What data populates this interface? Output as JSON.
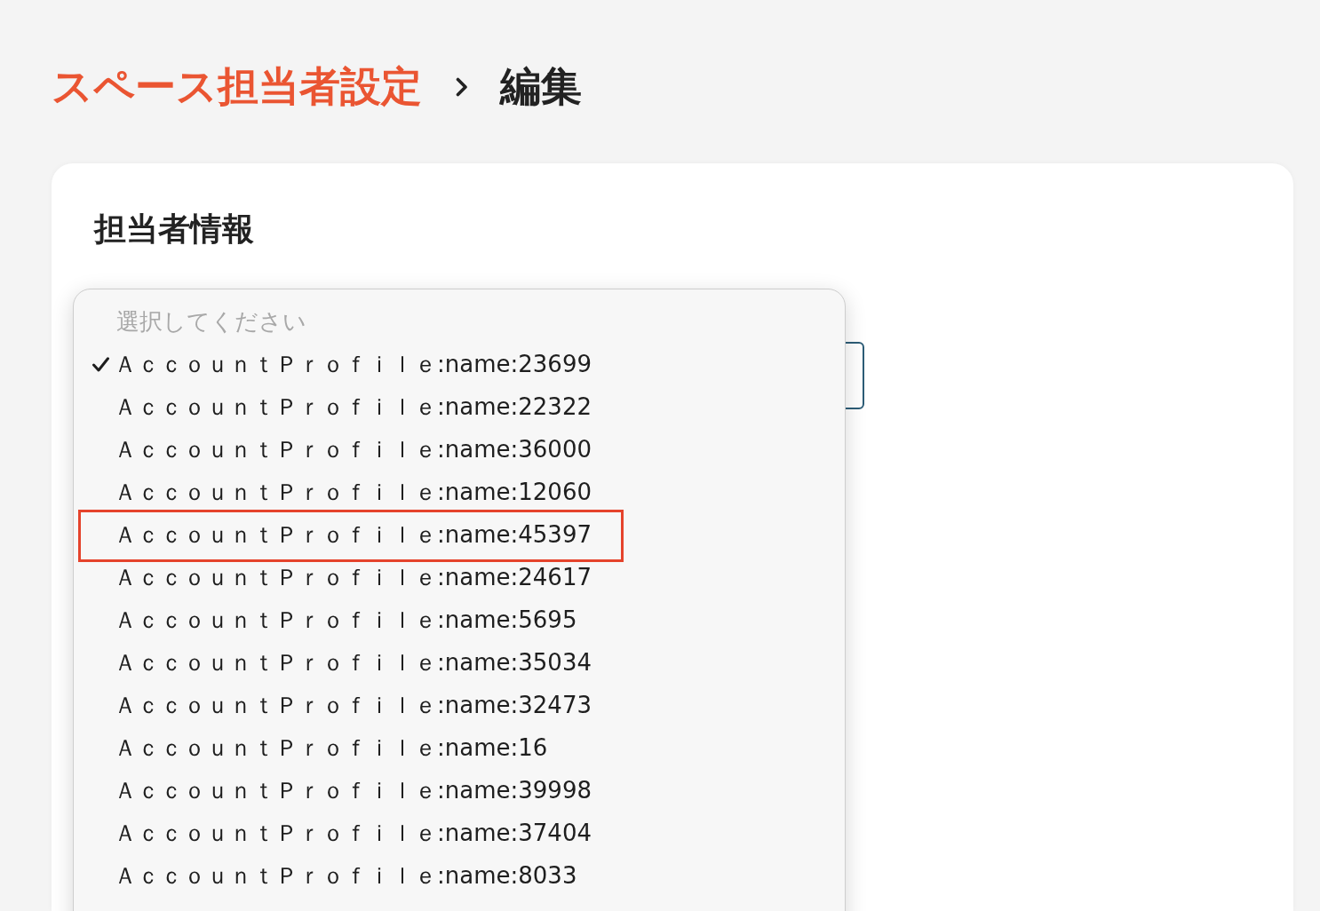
{
  "breadcrumb": {
    "parent": "スペース担当者設定",
    "current": "編集"
  },
  "section": {
    "title": "担当者情報"
  },
  "dropdown": {
    "placeholder": "選択してください",
    "options": [
      {
        "label": "ＡｃｃｏｕｎｔＰｒｏｆｉｌｅ:name:23699",
        "selected": true,
        "highlighted": false
      },
      {
        "label": "ＡｃｃｏｕｎｔＰｒｏｆｉｌｅ:name:22322",
        "selected": false,
        "highlighted": false
      },
      {
        "label": "ＡｃｃｏｕｎｔＰｒｏｆｉｌｅ:name:36000",
        "selected": false,
        "highlighted": false
      },
      {
        "label": "ＡｃｃｏｕｎｔＰｒｏｆｉｌｅ:name:12060",
        "selected": false,
        "highlighted": false
      },
      {
        "label": "ＡｃｃｏｕｎｔＰｒｏｆｉｌｅ:name:45397",
        "selected": false,
        "highlighted": true
      },
      {
        "label": "ＡｃｃｏｕｎｔＰｒｏｆｉｌｅ:name:24617",
        "selected": false,
        "highlighted": false
      },
      {
        "label": "ＡｃｃｏｕｎｔＰｒｏｆｉｌｅ:name:5695",
        "selected": false,
        "highlighted": false
      },
      {
        "label": "ＡｃｃｏｕｎｔＰｒｏｆｉｌｅ:name:35034",
        "selected": false,
        "highlighted": false
      },
      {
        "label": "ＡｃｃｏｕｎｔＰｒｏｆｉｌｅ:name:32473",
        "selected": false,
        "highlighted": false
      },
      {
        "label": "ＡｃｃｏｕｎｔＰｒｏｆｉｌｅ:name:16",
        "selected": false,
        "highlighted": false
      },
      {
        "label": "ＡｃｃｏｕｎｔＰｒｏｆｉｌｅ:name:39998",
        "selected": false,
        "highlighted": false
      },
      {
        "label": "ＡｃｃｏｕｎｔＰｒｏｆｉｌｅ:name:37404",
        "selected": false,
        "highlighted": false
      },
      {
        "label": "ＡｃｃｏｕｎｔＰｒｏｆｉｌｅ:name:8033",
        "selected": false,
        "highlighted": false
      }
    ]
  }
}
